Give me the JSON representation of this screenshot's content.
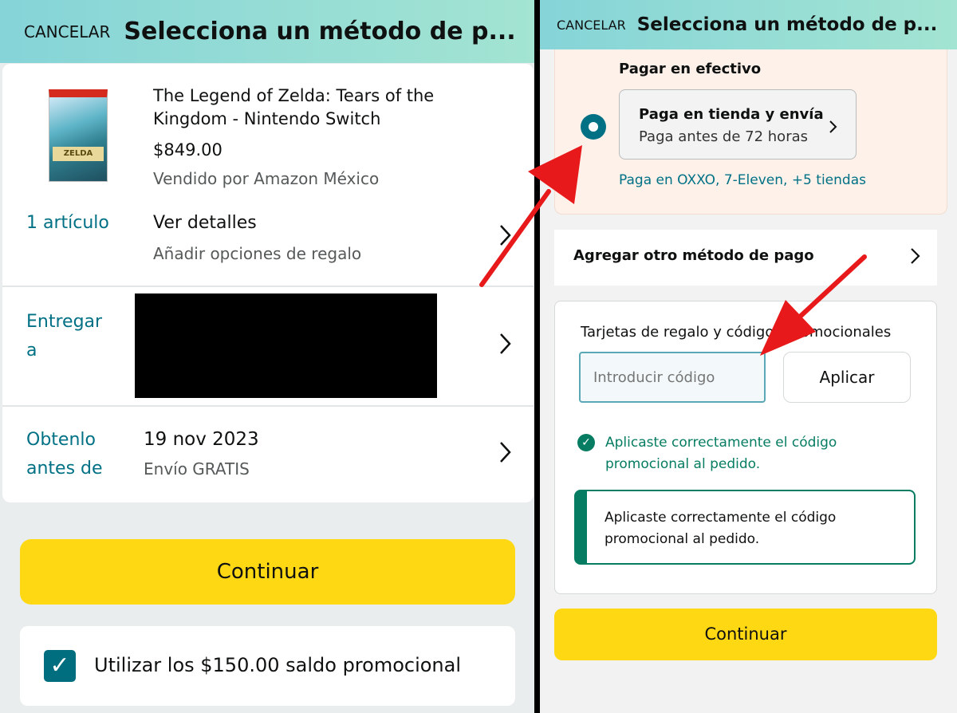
{
  "left": {
    "header": {
      "cancel": "CANCELAR",
      "title": "Selecciona un método de p..."
    },
    "product": {
      "image_label": "ZELDA",
      "title_line1": "The Legend of Zelda: Tears of the",
      "title_line2": "Kingdom - Nintendo Switch",
      "price": "$849.00",
      "seller": "Vendido por Amazon México"
    },
    "items_row": {
      "count": "1 artículo",
      "title": "Ver detalles",
      "subtitle": "Añadir opciones de regalo"
    },
    "deliver_row": {
      "label_line1": "Entregar",
      "label_line2": "a"
    },
    "date_row": {
      "label_line1": "Obtenlo",
      "label_line2": "antes de",
      "date": "19 nov 2023",
      "shipping": "Envío GRATIS"
    },
    "continue_label": "Continuar",
    "promo_balance": "Utilizar los $150.00 saldo promocional"
  },
  "right": {
    "header": {
      "cancel": "CANCELAR",
      "title": "Selecciona un método de p..."
    },
    "cash": {
      "title": "Pagar en efectivo",
      "option_title": "Paga en tienda y envía",
      "option_subtitle": "Paga antes de 72 horas",
      "stores": "Paga en OXXO, 7-Eleven, +5 tiendas"
    },
    "add_method": "Agregar otro método de pago",
    "gift": {
      "title": "Tarjetas de regalo y códigos promocionales",
      "input_placeholder": "Introducir código",
      "apply_label": "Aplicar",
      "success_line1": "Aplicaste correctamente el código",
      "success_line2": "promocional al pedido.",
      "alert_line1": "Aplicaste correctamente el código",
      "alert_line2": "promocional al pedido."
    },
    "continue_label": "Continuar"
  },
  "colors": {
    "header_gradient_start": "#86d4d8",
    "header_gradient_end": "#a3e4d2",
    "link_teal": "#007185",
    "success_green": "#067d62",
    "button_yellow": "#ffd814",
    "annotation_red": "#e8191b"
  },
  "icons": [
    "chevron-right-icon",
    "radio-selected-icon",
    "check-circle-icon",
    "checkbox-checked-icon",
    "annotation-arrow"
  ]
}
